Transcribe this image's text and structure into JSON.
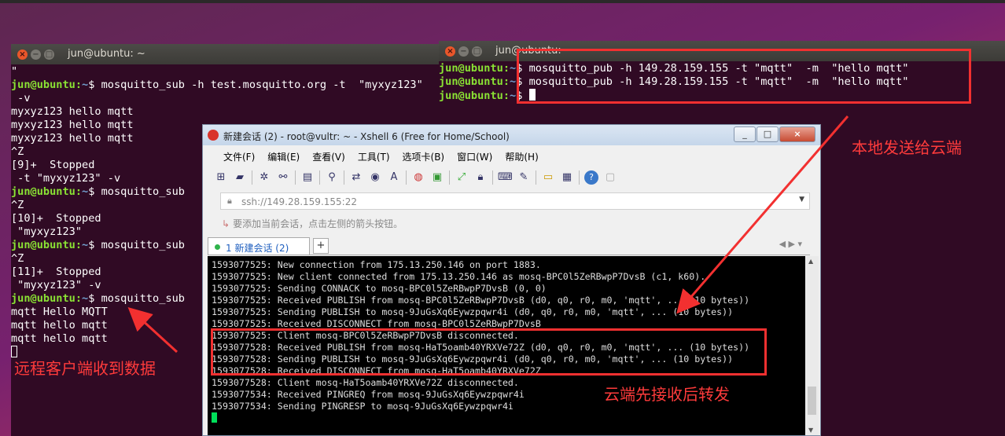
{
  "left_terminal": {
    "title": "jun@ubuntu: ~",
    "lines": [
      {
        "text": "\""
      },
      {
        "prompt": "jun@ubuntu",
        "path": "~",
        "cmd": "$ mosquitto_sub -h test.mosquitto.org -t  \"myxyz123\""
      },
      {
        "text": " -v"
      },
      {
        "text": "myxyz123 hello mqtt"
      },
      {
        "text": "myxyz123 hello mqtt"
      },
      {
        "text": "myxyz123 hello mqtt"
      },
      {
        "text": "^Z"
      },
      {
        "text": "[9]+  Stopped"
      },
      {
        "text": " -t \"myxyz123\" -v"
      },
      {
        "prompt": "jun@ubuntu",
        "path": "~",
        "cmd": "$ mosquitto_sub"
      },
      {
        "text": "^Z"
      },
      {
        "text": "[10]+  Stopped"
      },
      {
        "text": " \"myxyz123\""
      },
      {
        "prompt": "jun@ubuntu",
        "path": "~",
        "cmd": "$ mosquitto_sub"
      },
      {
        "text": "^Z"
      },
      {
        "text": "[11]+  Stopped"
      },
      {
        "text": " \"myxyz123\" -v"
      },
      {
        "prompt": "jun@ubuntu",
        "path": "~",
        "cmd": "$ mosquitto_sub"
      },
      {
        "text": "mqtt Hello MQTT"
      },
      {
        "text": "mqtt hello mqtt"
      },
      {
        "text": "mqtt hello mqtt"
      }
    ]
  },
  "right_terminal": {
    "title": "jun@ubuntu: ~",
    "lines": [
      {
        "prompt": "jun@ubuntu",
        "path": "~",
        "cmd": "$ mosquitto_pub -h 149.28.159.155 -t \"mqtt\"  -m  \"hello mqtt\""
      },
      {
        "prompt": "jun@ubuntu",
        "path": "~",
        "cmd": "$ mosquitto_pub -h 149.28.159.155 -t \"mqtt\"  -m  \"hello mqtt\""
      },
      {
        "prompt": "jun@ubuntu",
        "path": "~",
        "cmd": "$ "
      }
    ]
  },
  "xshell": {
    "title": "新建会话 (2) - root@vultr: ~ - Xshell 6 (Free for Home/School)",
    "menu": [
      "文件(F)",
      "编辑(E)",
      "查看(V)",
      "工具(T)",
      "选项卡(B)",
      "窗口(W)",
      "帮助(H)"
    ],
    "address": "ssh://149.28.159.155:22",
    "hint": "要添加当前会话，点击左侧的箭头按钮。",
    "tab_label": "1 新建会话 (2)",
    "log": [
      "1593077525: New connection from 175.13.250.146 on port 1883.",
      "1593077525: New client connected from 175.13.250.146 as mosq-BPC0l5ZeRBwpP7DvsB (c1, k60).",
      "1593077525: Sending CONNACK to mosq-BPC0l5ZeRBwpP7DvsB (0, 0)",
      "1593077525: Received PUBLISH from mosq-BPC0l5ZeRBwpP7DvsB (d0, q0, r0, m0, 'mqtt', ... (10 bytes))",
      "1593077525: Sending PUBLISH to mosq-9JuGsXq6Eywzpqwr4i (d0, q0, r0, m0, 'mqtt', ... (10 bytes))",
      "1593077525: Received DISCONNECT from mosq-BPC0l5ZeRBwpP7DvsB",
      "1593077525: Client mosq-BPC0l5ZeRBwpP7DvsB disconnected.",
      "1593077528: Received PUBLISH from mosq-HaT5oamb40YRXVe72Z (d0, q0, r0, m0, 'mqtt', ... (10 bytes))",
      "1593077528: Sending PUBLISH to mosq-9JuGsXq6Eywzpqwr4i (d0, q0, r0, m0, 'mqtt', ... (10 bytes))",
      "1593077528: Received DISCONNECT from mosq-HaT5oamb40YRXVe72Z",
      "1593077528: Client mosq-HaT5oamb40YRXVe72Z disconnected.",
      "1593077534: Received PINGREQ from mosq-9JuGsXq6Eywzpqwr4i",
      "1593077534: Sending PINGRESP to mosq-9JuGsXq6Eywzpqwr4i"
    ]
  },
  "annotations": {
    "local_to_cloud": "本地发送给云端",
    "cloud_forward": "云端先接收后转发",
    "remote_received": "远程客户端收到数据",
    "color": "#ff3b3b"
  },
  "colors": {
    "prompt_user": "#8ae234",
    "prompt_path": "#729fcf",
    "terminal_bg": "#300a24",
    "cursor": "#00e05a"
  }
}
